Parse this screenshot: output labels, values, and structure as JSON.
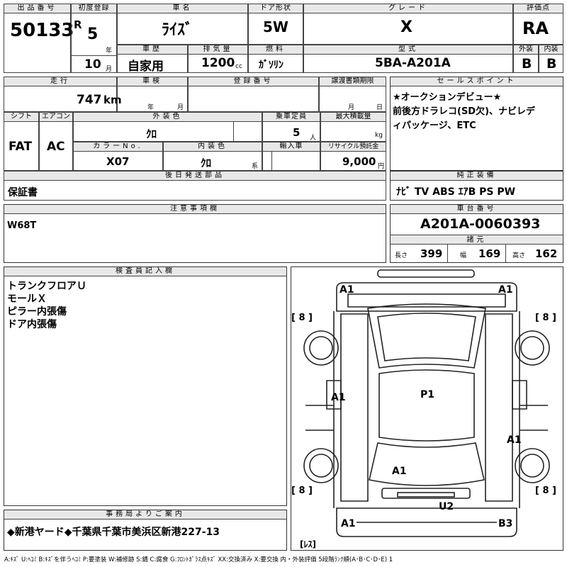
{
  "header": {
    "lot_no": {
      "label": "出品番号",
      "value": "50133"
    },
    "first_reg": {
      "label": "初度登録",
      "era": "R",
      "year": "5",
      "year_unit": "年",
      "month": "10",
      "month_unit": "月"
    },
    "car_name": {
      "label": "車名",
      "value": "ﾗｲｽﾞ"
    },
    "door": {
      "label": "ドア形状",
      "value": "5W"
    },
    "grade": {
      "label": "グレード",
      "value": "X"
    },
    "score": {
      "label": "評価点",
      "value": "RA"
    },
    "history": {
      "label": "車歴",
      "value": "自家用"
    },
    "displacement": {
      "label": "排気量",
      "value": "1200",
      "unit": "cc"
    },
    "fuel": {
      "label": "燃料",
      "value": "ｶﾞｿﾘﾝ"
    },
    "model": {
      "label": "型式",
      "value": "5BA-A201A"
    },
    "exterior_score": {
      "label": "外装",
      "value": "B"
    },
    "interior_score": {
      "label": "内装",
      "value": "B"
    }
  },
  "row2": {
    "mileage": {
      "label": "走行",
      "value": "747",
      "unit": "km"
    },
    "inspection": {
      "label": "車検",
      "year_unit": "年",
      "month_unit": "月"
    },
    "reg_no": {
      "label": "登録番号"
    },
    "transfer": {
      "label": "譲渡書類期限",
      "month_unit": "月",
      "day_unit": "日"
    },
    "shift": {
      "label": "シフト",
      "value": "FAT"
    },
    "ac": {
      "label": "エアコン",
      "value": "AC"
    },
    "ext_color": {
      "label": "外装色",
      "value": "ｸﾛ"
    },
    "capacity": {
      "label": "乗車定員",
      "value": "5",
      "unit": "人"
    },
    "max_load": {
      "label": "最大積載量",
      "unit": "kg"
    },
    "color_no": {
      "label": "カラーNo.",
      "value": "X07"
    },
    "int_color": {
      "label": "内装色",
      "value": "ｸﾛ",
      "unit": "系"
    },
    "import": {
      "label": "輸入車"
    },
    "recycle": {
      "label": "リサイクル預託金",
      "value": "9,000",
      "unit": "円"
    }
  },
  "sales_point": {
    "label": "セールスポイント",
    "lines": [
      "★オークションデビュー★",
      "前後方ドラレコ(SD欠)、ナビレデ",
      "ィパッケージ、ETC"
    ]
  },
  "later_parts": {
    "label": "後日発送部品",
    "value": "保証書"
  },
  "genuine": {
    "label": "純正装備",
    "value": "ﾅﾋﾞ TV ABS ｴｱB PS PW"
  },
  "notes": {
    "label": "注意事項欄",
    "value": "W68T"
  },
  "chassis": {
    "label": "車台番号",
    "value": "A201A-0060393"
  },
  "dims": {
    "label": "諸元",
    "length_label": "長さ",
    "length": "399",
    "width_label": "幅",
    "width": "169",
    "height_label": "高さ",
    "height": "162"
  },
  "inspector": {
    "label": "検査員記入欄",
    "lines": [
      "トランクフロアＵ",
      "モールＸ",
      "ピラー内張傷",
      "ドア内張傷"
    ]
  },
  "office": {
    "label": "事務局よりご案内",
    "value": "◆新港ヤード◆千葉県千葉市美浜区新港227-13"
  },
  "diagram": {
    "marks": [
      "A1",
      "A1",
      "A1",
      "P1",
      "A1",
      "A1",
      "U2",
      "A1",
      "B3"
    ],
    "tire_marks": [
      "[ 8 ]",
      "[ 8 ]",
      "[ 8 ]",
      "[ 8 ]"
    ],
    "spare": "[ﾚｽ]"
  },
  "legend": "A:ｷｽﾞ U:ﾍｺﾐ B:ｷｽﾞを伴うﾍｺﾐ P:要塗装 W:補修跡 S:錆 C:腐食 G:ﾌﾛﾝﾄｶﾞﾗｽ点ｷｽﾞ XX:交換済み X:要交換 内・外装評価 5段階ﾗﾝｸ順(A･B･C･D･E) 1"
}
